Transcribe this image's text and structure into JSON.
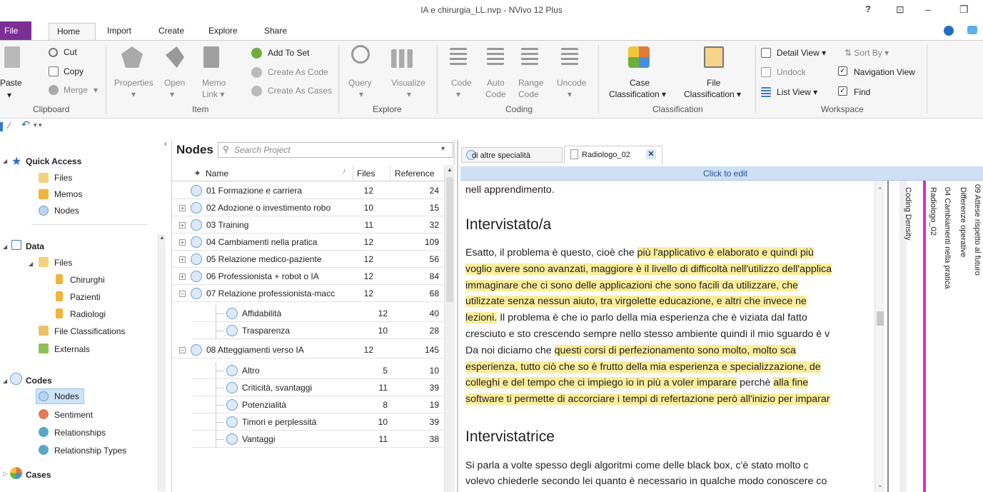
{
  "window": {
    "title": "IA e chirurgia_LL.nvp - NVivo 12 Plus",
    "help": "?",
    "restore": "⊡",
    "minimize": "–",
    "maximize": "❐"
  },
  "ribbon_tabs": [
    "File",
    "Home",
    "Import",
    "Create",
    "Explore",
    "Share"
  ],
  "ribbon": {
    "clipboard": {
      "paste": "Paste",
      "cut": "Cut",
      "copy": "Copy",
      "merge": "Merge",
      "group": "Clipboard"
    },
    "item": {
      "properties": "Properties",
      "open": "Open",
      "memo": "Memo",
      "link": "Link",
      "add_to_set": "Add To Set",
      "create_as_code": "Create As Code",
      "create_as_cases": "Create As Cases",
      "group": "Item"
    },
    "explore": {
      "query": "Query",
      "visualize": "Visualize",
      "group": "Explore"
    },
    "coding": {
      "code": "Code",
      "auto": "Auto",
      "auto2": "Code",
      "range": "Range",
      "range2": "Code",
      "uncode": "Uncode",
      "group": "Coding"
    },
    "classification": {
      "case": "Case",
      "case2": "Classification",
      "file": "File",
      "file2": "Classification",
      "group": "Classification"
    },
    "workspace": {
      "detail_view": "Detail View",
      "sort_by": "Sort By",
      "undock": "Undock",
      "navigation_view": "Navigation View",
      "list_view": "List View",
      "find": "Find",
      "group": "Workspace"
    }
  },
  "nav": {
    "quick_access": "Quick Access",
    "qa_items": [
      "Files",
      "Memos",
      "Nodes"
    ],
    "data": "Data",
    "files": "Files",
    "file_folders": [
      "Chirurghi",
      "Pazienti",
      "Radiologi"
    ],
    "file_classifications": "File Classifications",
    "externals": "Externals",
    "codes": "Codes",
    "code_items": [
      "Nodes",
      "Sentiment",
      "Relationships",
      "Relationship Types"
    ],
    "cases": "Cases"
  },
  "nodes_panel": {
    "title": "Nodes",
    "search_placeholder": "Search Project",
    "col_name": "Name",
    "col_files": "Files",
    "col_refs": "Reference",
    "rows": [
      {
        "name": "01 Formazione e carriera",
        "files": "12",
        "refs": "24"
      },
      {
        "name": "02 Adozione o investimento robo",
        "files": "10",
        "refs": "15"
      },
      {
        "name": "03 Training",
        "files": "11",
        "refs": "32"
      },
      {
        "name": "04 Cambiamenti nella pratica",
        "files": "12",
        "refs": "109"
      },
      {
        "name": "05 Relazione medico-paziente",
        "files": "12",
        "refs": "56"
      },
      {
        "name": "06 Professionista + robot o IA",
        "files": "12",
        "refs": "84"
      },
      {
        "name": "07 Relazione professionista-macc",
        "files": "12",
        "refs": "68"
      },
      {
        "name": "Affidabilità",
        "files": "12",
        "refs": "40"
      },
      {
        "name": "Trasparenza",
        "files": "10",
        "refs": "28"
      },
      {
        "name": "08 Atteggiamenti verso IA",
        "files": "12",
        "refs": "145"
      },
      {
        "name": "Altro",
        "files": "5",
        "refs": "10"
      },
      {
        "name": "Criticità, svantaggi",
        "files": "11",
        "refs": "39"
      },
      {
        "name": "Potenzialità",
        "files": "8",
        "refs": "19"
      },
      {
        "name": "Timori e perplessità",
        "files": "10",
        "refs": "39"
      },
      {
        "name": "Vantaggi",
        "files": "11",
        "refs": "38"
      }
    ]
  },
  "doc": {
    "tab1": "di altre specialità",
    "tab2": "Radiologo_02",
    "click_to_edit": "Click to edit",
    "line0": "nell apprendimento.",
    "heading1": "Intervistato/a",
    "p1": [
      {
        "a": "Esatto, il problema è questo, cioè che ",
        "h": "più l'applicativo è elaborato e quindi più"
      },
      {
        "a": "",
        "h": "voglio avere sono avanzati, maggiore è il livello di difficoltà nell'utilizzo dell'applica"
      },
      {
        "a": "",
        "h": "immaginare che ci sono delle applicazioni che sono facili da utilizzare, che"
      },
      {
        "a": "",
        "h": "utilizzate senza nessun aiuto, tra virgolette educazione, e altri che invece ne"
      },
      {
        "a": "",
        "h": "lezioni.",
        "b": " Il problema è che io parlo della mia esperienza che è viziata dal fatto"
      },
      {
        "a": "cresciuto e sto crescendo sempre nello stesso ambiente quindi il mio sguardo è v",
        "h": ""
      },
      {
        "a": "Da noi diciamo che ",
        "h": "questi corsi di perfezionamento sono molto, molto sca"
      },
      {
        "a": "",
        "h": "esperienza, tutto ciò che so è frutto della mia esperienza e specializzazione, de"
      },
      {
        "a": "",
        "h": "colleghi e del tempo che ci impiego io in più a voler imparare",
        "b": " perchè ",
        "h2": "alla fine"
      },
      {
        "a": "",
        "h": "software ti permette di accorciare i tempi di refertazione però all'inizio per imparar"
      }
    ],
    "heading2": "Intervistatrice",
    "p2": [
      "Si parla a volte spesso degli algoritmi come delle black box, c'è stato molto c",
      "volevo chiederle secondo lei quanto è necessario in qualche modo conoscere co"
    ],
    "stripes": [
      "Coding Density",
      "Radiologo_02",
      "04 Cambiamenti nella pratica",
      "Differenze operative",
      "09 Attese rispetto al futuro"
    ]
  },
  "colors": {
    "file_tab": "#7b2f93",
    "highlight": "#fbed9b",
    "stripe": "#d52bd2",
    "click_bar": "#cfe0f5"
  }
}
